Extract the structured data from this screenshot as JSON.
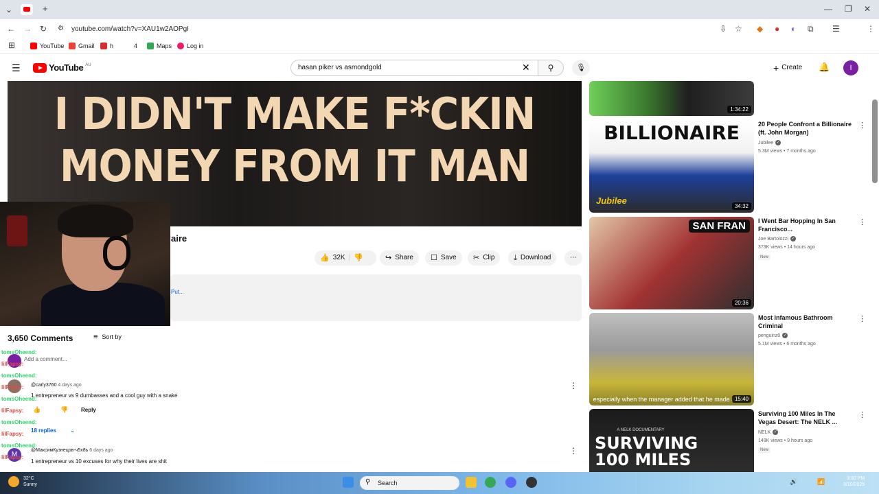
{
  "browser": {
    "url": "youtube.com/watch?v=XAU1w2AOPgI",
    "bookmarks": [
      {
        "label": "YouTube",
        "color": "#ff0000"
      },
      {
        "label": "Gmail",
        "color": "#ea4335"
      },
      {
        "label": "h",
        "color": "#d32f2f"
      },
      {
        "label": "4",
        "color": "#ffffff"
      },
      {
        "label": "Maps",
        "color": "#34a853"
      },
      {
        "label": "Log in",
        "color": "#e91e63"
      }
    ]
  },
  "header": {
    "logo_text": "YouTube",
    "logo_country": "AU",
    "search_value": "hasan piker vs asmondgold",
    "create_label": "Create",
    "avatar_letter": "I"
  },
  "video": {
    "caption_line1": "I DIDN'T MAKE F*CKIN",
    "caption_line2": "MONEY FROM IT MAN",
    "title_fragment": "aire",
    "actions": {
      "likes": "32K",
      "share": "Share",
      "save": "Save",
      "clip": "Clip",
      "download": "Download"
    },
    "description_more": "Put..."
  },
  "comments": {
    "count_label": "3,650 Comments",
    "sort_label": "Sort by",
    "add_placeholder": "Add a comment...",
    "items": [
      {
        "author": "@carly3760",
        "age": "4 days ago",
        "text": "1 entrepreneur vs 9 dumbasses and a cool guy with a snake",
        "reply_label": "Reply",
        "replies_label": "18 replies"
      },
      {
        "author": "@МаксимКузнецов-ч5х8ь",
        "age": "6 days ago",
        "avatar_letter": "M",
        "text": "1 entrepreneur vs 10 excuses for why their lives are shit"
      }
    ]
  },
  "sidebar": {
    "items": [
      {
        "duration": "1:34:22"
      },
      {
        "title": "20 People Confront a Billionaire (ft. John Morgan)",
        "channel": "Jubilee",
        "meta": "5.3M views • 7 months ago",
        "thumb_text": "BILLIONAIRE",
        "thumb_brand": "Jubilee",
        "duration": "34:32"
      },
      {
        "title": "I Went Bar Hopping In San Francisco...",
        "channel": "Joe Bartolozzi",
        "meta": "373K views • 14 hours ago",
        "badge": "New",
        "thumb_text": "SAN FRAN",
        "duration": "20:36"
      },
      {
        "title": "Most Infamous Bathroom Criminal",
        "channel": "penguinz0",
        "meta": "5.1M views • 6 months ago",
        "thumb_text": "especially when the manager added that he made a habit",
        "duration": "15:40"
      },
      {
        "title": "Surviving 100 Miles In The Vegas Desert: The NELK ...",
        "channel": "NELK",
        "meta": "149K views • 9 hours ago",
        "badge": "New",
        "thumb_kicker": "A NELK DOCUMENTARY",
        "thumb_text": "SURVIVING 100 MILES"
      }
    ]
  },
  "chat_overlay": [
    "tomsOheend:",
    "lilFapsy:",
    "tomsOheend:",
    "lilFapsy:",
    "tomsOheend:",
    "lilFapsy:",
    "tomsOheend:",
    "lilFapsy:",
    "tomsOheend:",
    "lilFapsy:"
  ],
  "taskbar": {
    "weather_temp": "32°C",
    "weather_desc": "Sunny",
    "search_label": "Search",
    "time": "3:30 PM",
    "date": "3/10/2025"
  }
}
